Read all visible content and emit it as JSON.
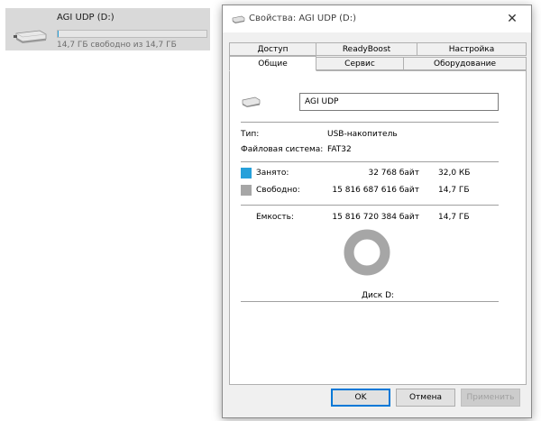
{
  "explorer": {
    "drive_name": "AGI UDP (D:)",
    "free_text": "14,7 ГБ свободно из 14,7 ГБ",
    "usage_fraction": 0.002
  },
  "dialog": {
    "title": "Свойства: AGI UDP (D:)",
    "tabs_back": [
      "Доступ",
      "ReadyBoost",
      "Настройка"
    ],
    "tabs_front": [
      "Общие",
      "Сервис",
      "Оборудование"
    ],
    "active_tab": "Общие",
    "general": {
      "name_value": "AGI UDP",
      "type_label": "Тип:",
      "type_value": "USB-накопитель",
      "fs_label": "Файловая система:",
      "fs_value": "FAT32",
      "used_label": "Занято:",
      "used_bytes": "32 768 байт",
      "used_size": "32,0 КБ",
      "free_label": "Свободно:",
      "free_bytes": "15 816 687 616 байт",
      "free_size": "14,7 ГБ",
      "capacity_label": "Емкость:",
      "capacity_bytes": "15 816 720 384 байт",
      "capacity_size": "14,7 ГБ",
      "disk_label": "Диск D:",
      "used_fraction": 2e-06
    },
    "buttons": {
      "ok": "OK",
      "cancel": "Отмена",
      "apply": "Применить"
    }
  },
  "colors": {
    "used": "#26a0da",
    "free": "#a6a6a6",
    "accent": "#0078d7"
  }
}
